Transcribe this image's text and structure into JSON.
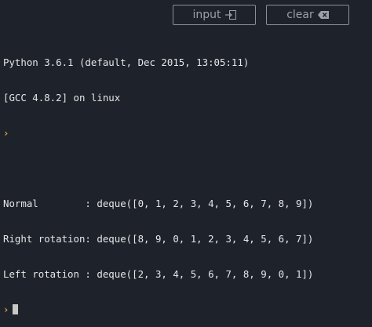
{
  "toolbar": {
    "input_label": "input",
    "input_icon": "enter-icon",
    "clear_label": "clear",
    "clear_icon": "backspace-icon"
  },
  "console": {
    "header": [
      "Python 3.6.1 (default, Dec 2015, 13:05:11)",
      "[GCC 4.8.2] on linux"
    ],
    "prompt_glyph": "›",
    "output": [
      "Normal        : deque([0, 1, 2, 3, 4, 5, 6, 7, 8, 9])",
      "Right rotation: deque([8, 9, 0, 1, 2, 3, 4, 5, 6, 7])",
      "Left rotation : deque([2, 3, 4, 5, 6, 7, 8, 9, 0, 1])"
    ]
  },
  "colors": {
    "background": "#1d222b",
    "text": "#e6e6e6",
    "prompt": "#e8a33b",
    "button_border": "#8a8f98"
  }
}
